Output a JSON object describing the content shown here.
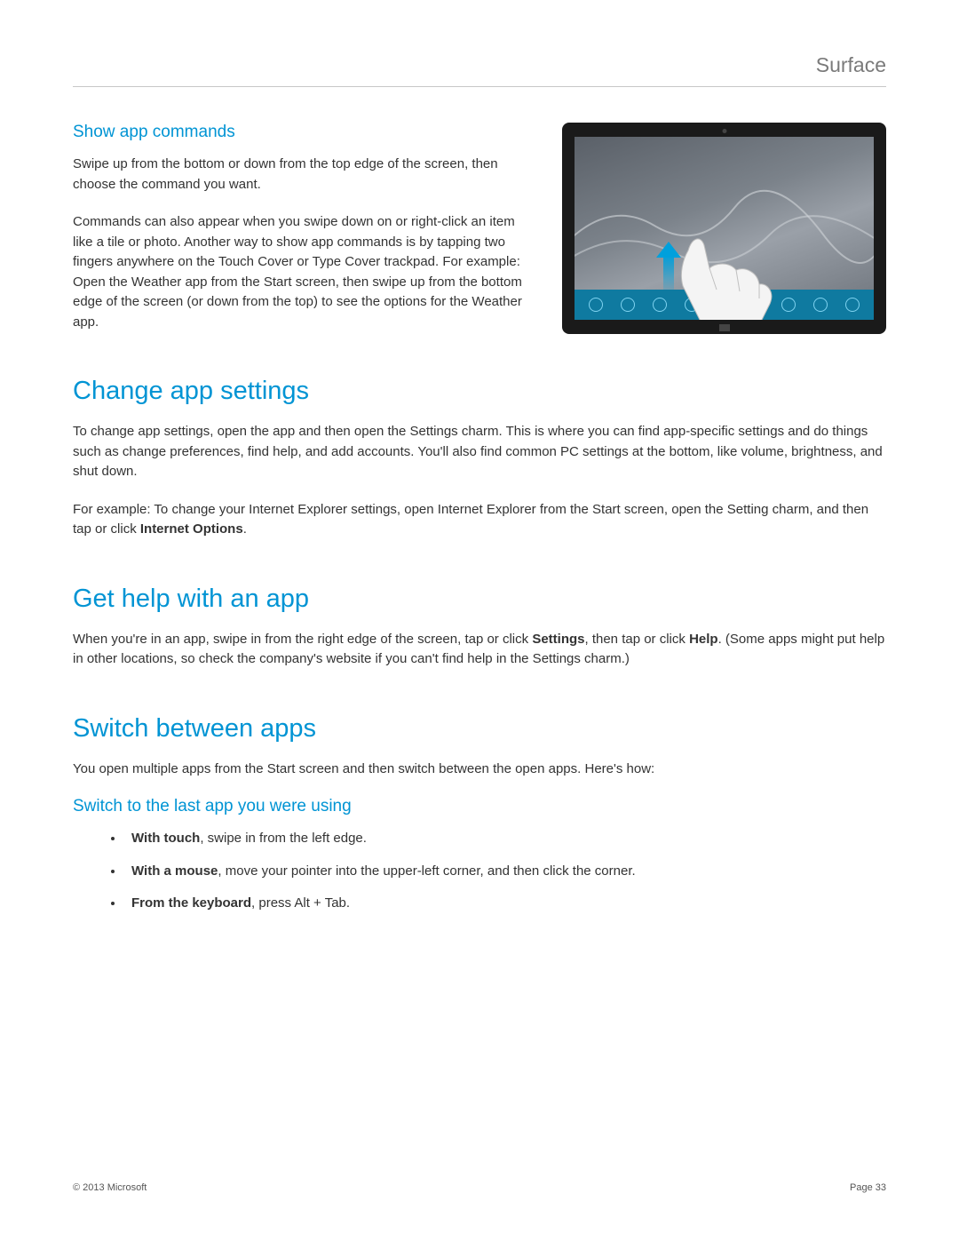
{
  "header": {
    "brand": "Surface"
  },
  "section1": {
    "title": "Show app commands",
    "p1": "Swipe up from the bottom or down from the top edge of the screen, then choose the command you want.",
    "p2": "Commands can also appear when you swipe down on or right-click an item like a tile or photo. Another way to show app commands is by tapping two fingers anywhere on the Touch Cover or Type Cover trackpad. For example: Open the Weather app from the Start screen, then swipe up from the bottom edge of the screen (or down from the top) to see the options for the Weather app."
  },
  "section2": {
    "title": "Change app settings",
    "p1": "To change app settings, open the app and then open the Settings charm. This is where you can find app-specific settings and do things such as change preferences, find help, and add accounts. You'll also find common PC settings at the bottom, like volume, brightness, and shut down.",
    "p2a": "For example: To change your Internet Explorer settings, open Internet Explorer from the Start screen, open the Setting charm, and then tap or click ",
    "p2b_bold": "Internet Options",
    "p2c": "."
  },
  "section3": {
    "title": "Get help with an app",
    "p1a": "When you're in an app, swipe in from the right edge of the screen, tap or click ",
    "p1b_bold": "Settings",
    "p1c": ", then tap or click ",
    "p1d_bold": "Help",
    "p1e": ". (Some apps might put help in other locations, so check the company's website if you can't find help in the Settings charm.)"
  },
  "section4": {
    "title": "Switch between apps",
    "p1": "You open multiple apps from the Start screen and then switch between the open apps. Here's how:",
    "sub_title": "Switch to the last app you were using",
    "bullets": {
      "b1_bold": "With touch",
      "b1_rest": ", swipe in from the left edge.",
      "b2_bold": "With a mouse",
      "b2_rest": ", move your pointer into the upper-left corner, and then click the corner.",
      "b3_bold": "From the keyboard",
      "b3_rest": ", press Alt + Tab."
    }
  },
  "footer": {
    "copyright": "© 2013 Microsoft",
    "page": "Page 33"
  }
}
